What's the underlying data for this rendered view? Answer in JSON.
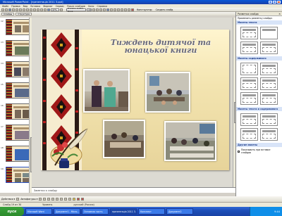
{
  "window": {
    "title": "Microsoft PowerPoint - [презентація 2011 3.ppt]"
  },
  "menu": [
    "Файл",
    "Правка",
    "Вид",
    "Вставка",
    "Формат",
    "Сервис",
    "Показ слайдов",
    "Окно",
    "Справка"
  ],
  "toolbar": {
    "zoom": "47%",
    "font": "Franklin Gothic Book",
    "font_size": "18",
    "designer_label": "Конструктор",
    "new_slide_label": "Создать слайд"
  },
  "toolbar2": {
    "tab_slides": "Слайды",
    "tab_outline": "Структура"
  },
  "thumbnails": {
    "numbers": [
      "12",
      "13",
      "14",
      "15",
      "16",
      "17",
      "18",
      "19"
    ]
  },
  "slide": {
    "title": "Тиждень дитячої та юнацької книги"
  },
  "notes": {
    "placeholder": "Заметки к слайду"
  },
  "taskpane": {
    "title": "Разметка слайда",
    "apply_label": "Применить разметку слайда:",
    "section_text": "Макеты текста",
    "section_content": "Макеты содержимого",
    "section_text_content": "Макеты текста и содержимого",
    "section_other": "Другие макеты",
    "checkbox_label": "Показывать при вставке слайдов"
  },
  "drawbar": {
    "actions": "Действия ▾",
    "autoshapes": "Автофигуры ▾"
  },
  "status": {
    "slide": "Слайд 19 из 30",
    "design": "Уровень",
    "lang": "русский (Россия)"
  },
  "taskbar": {
    "start": "пуск",
    "tasks": [
      "Microsoft Word",
      "Документ1 - Micro...",
      "Основная часть",
      "презентація 2011 3...",
      "Конспект",
      "Документ2"
    ],
    "clock": "9:44"
  },
  "colors": {
    "accent": "#0a58d8",
    "taskbar": "#1d4fb8",
    "start": "#2b8a2b"
  }
}
